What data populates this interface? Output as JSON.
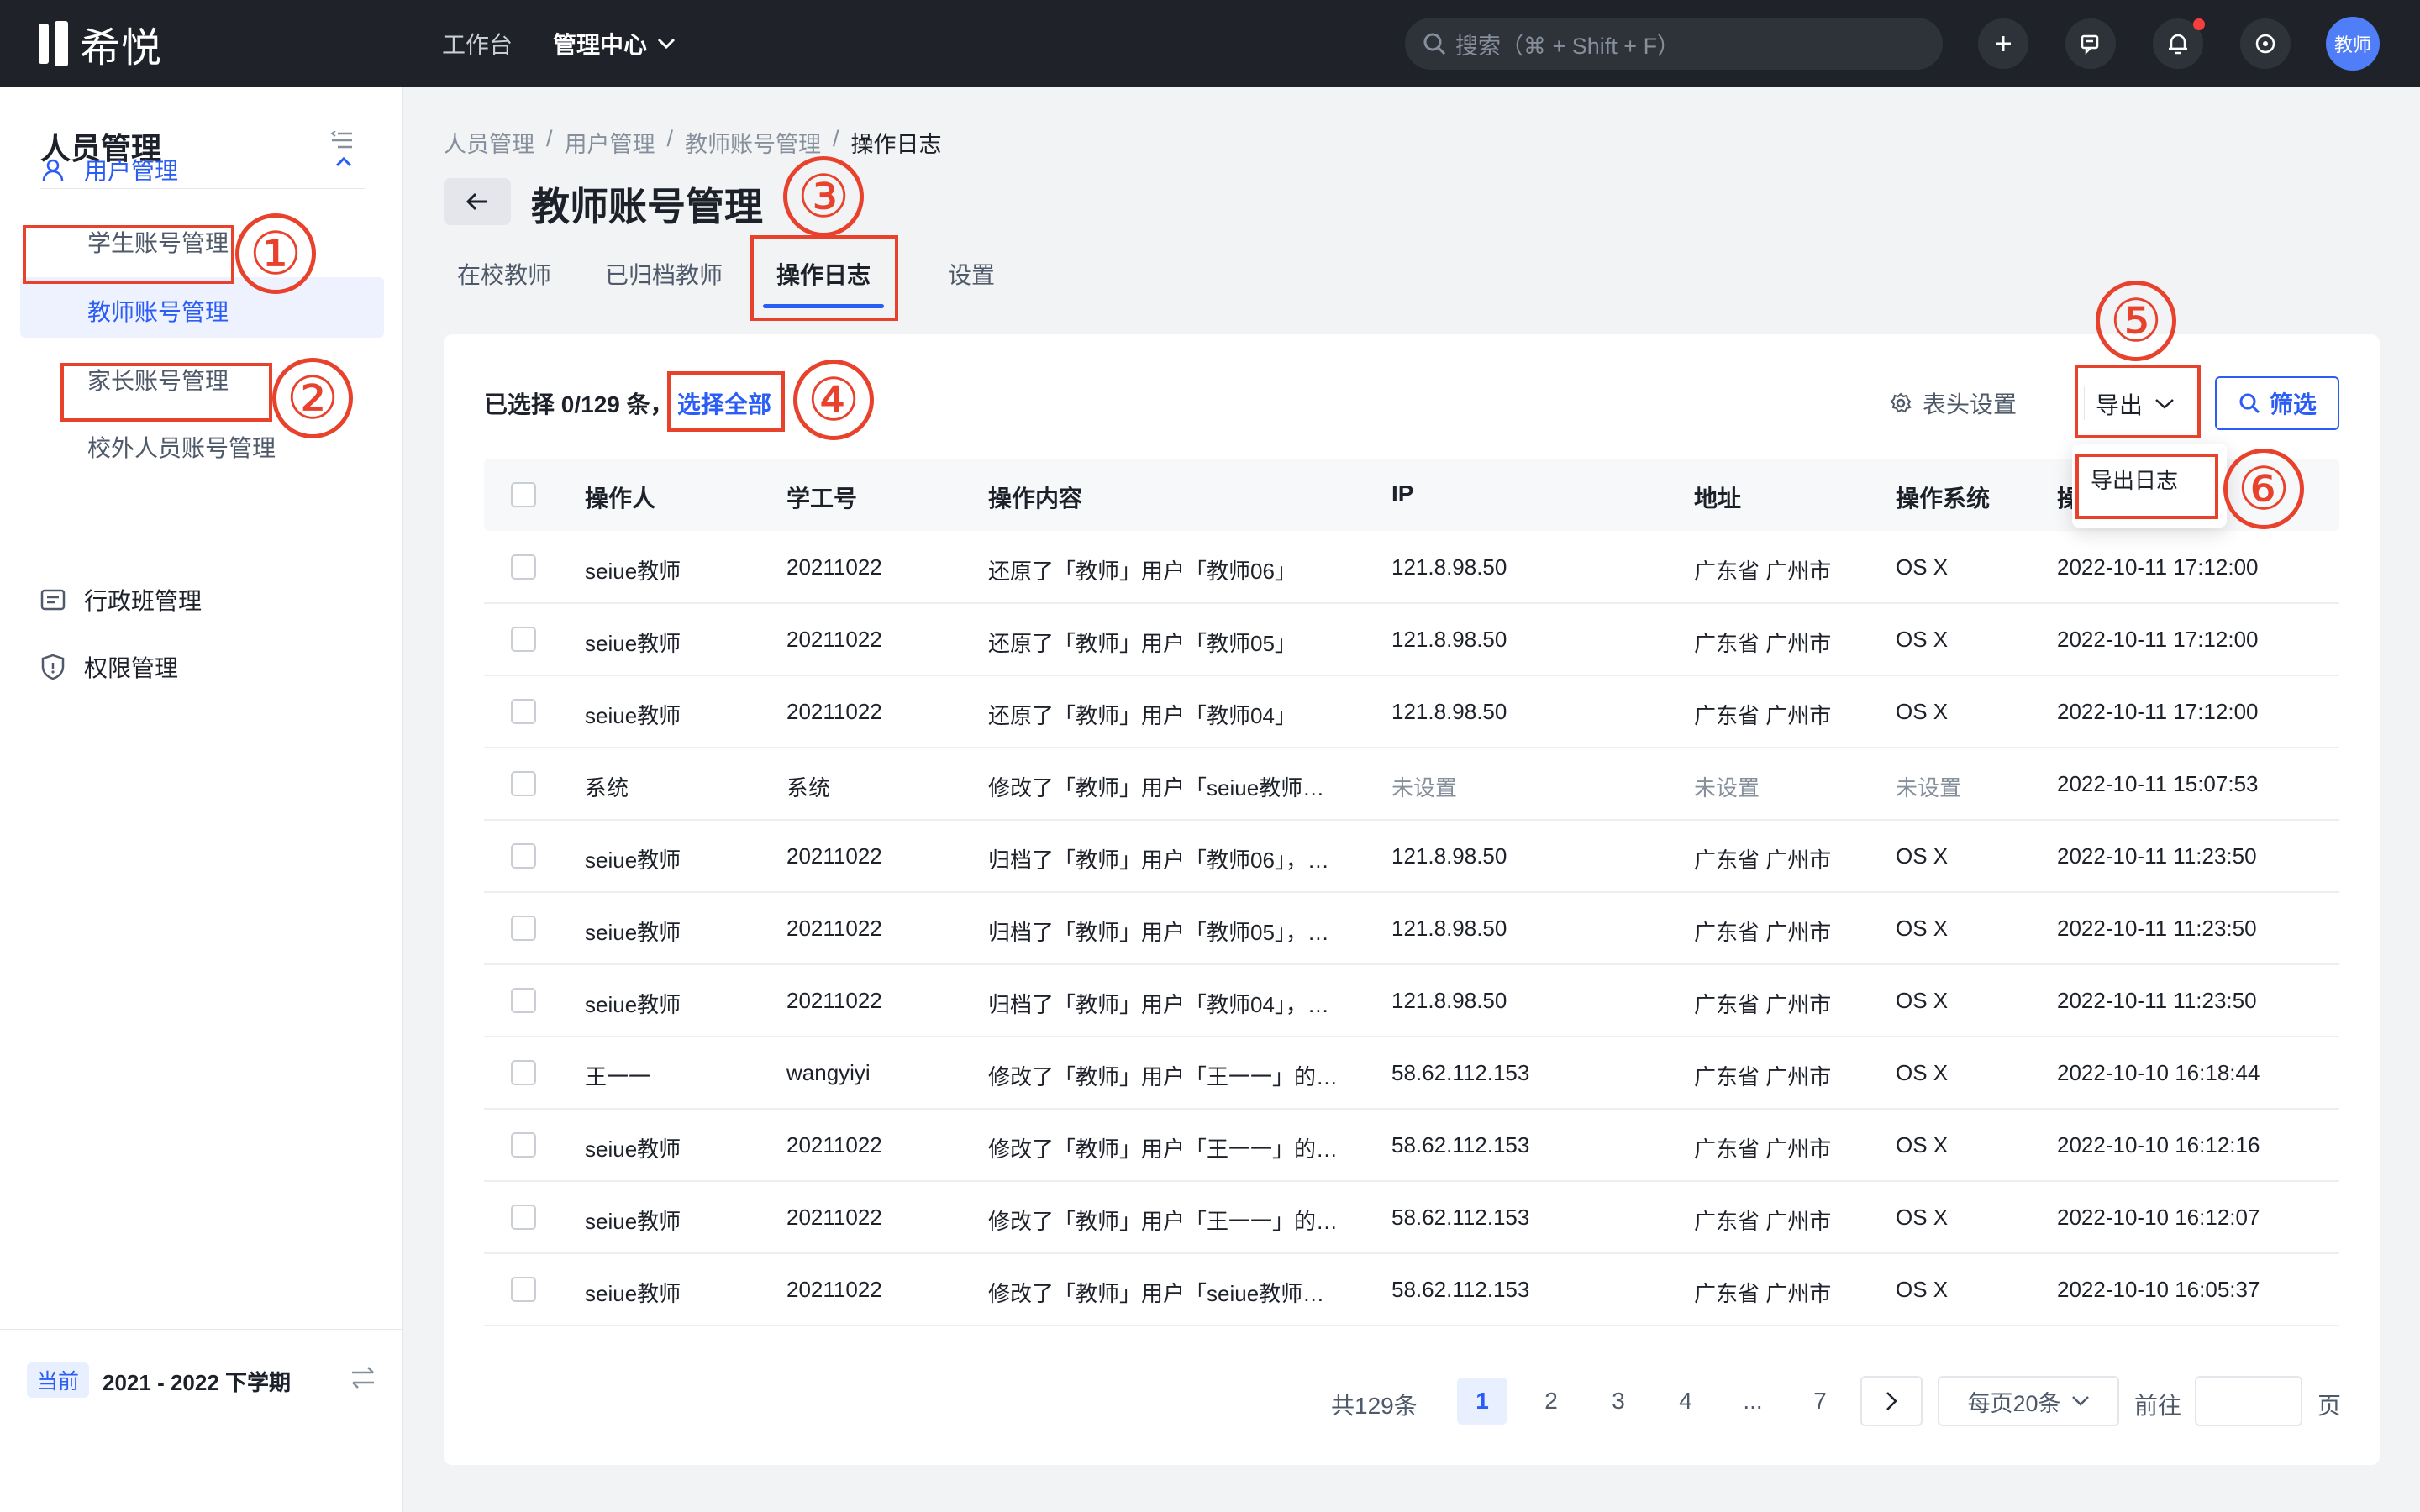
{
  "topbar": {
    "logo_text": "希悦",
    "nav_workbench": "工作台",
    "nav_admin": "管理中心",
    "search_placeholder": "搜索（⌘ + Shift + F）",
    "avatar_label": "教师"
  },
  "sidebar": {
    "title": "人员管理",
    "group_user": "用户管理",
    "sub_items": [
      "学生账号管理",
      "教师账号管理",
      "家长账号管理",
      "校外人员账号管理"
    ],
    "group_class": "行政班管理",
    "group_permission": "权限管理",
    "term_badge": "当前",
    "term_text": "2021 - 2022 下学期"
  },
  "breadcrumb": [
    "人员管理",
    "用户管理",
    "教师账号管理",
    "操作日志"
  ],
  "breadcrumb_sep": "/",
  "page_title": "教师账号管理",
  "tabs": [
    "在校教师",
    "已归档教师",
    "操作日志",
    "设置"
  ],
  "toolbar": {
    "selection_info": "已选择 0/129 条，",
    "select_all": "选择全部",
    "column_settings": "表头设置",
    "export": "导出",
    "filter": "筛选"
  },
  "export_menu": {
    "item": "导出日志"
  },
  "table": {
    "headers": [
      "操作人",
      "学工号",
      "操作内容",
      "IP",
      "地址",
      "操作系统",
      "操"
    ],
    "rows": [
      {
        "operator": "seiue教师",
        "id": "20211022",
        "content": "还原了「教师」用户「教师06」",
        "ip": "121.8.98.50",
        "address": "广东省 广州市",
        "os": "OS X",
        "time": "2022-10-11 17:12:00",
        "muted": false
      },
      {
        "operator": "seiue教师",
        "id": "20211022",
        "content": "还原了「教师」用户「教师05」",
        "ip": "121.8.98.50",
        "address": "广东省 广州市",
        "os": "OS X",
        "time": "2022-10-11 17:12:00",
        "muted": false
      },
      {
        "operator": "seiue教师",
        "id": "20211022",
        "content": "还原了「教师」用户「教师04」",
        "ip": "121.8.98.50",
        "address": "广东省 广州市",
        "os": "OS X",
        "time": "2022-10-11 17:12:00",
        "muted": false
      },
      {
        "operator": "系统",
        "id": "系统",
        "content": "修改了「教师」用户「seiue教师…",
        "ip": "未设置",
        "address": "未设置",
        "os": "未设置",
        "time": "2022-10-11 15:07:53",
        "muted": true
      },
      {
        "operator": "seiue教师",
        "id": "20211022",
        "content": "归档了「教师」用户「教师06」，…",
        "ip": "121.8.98.50",
        "address": "广东省 广州市",
        "os": "OS X",
        "time": "2022-10-11 11:23:50",
        "muted": false
      },
      {
        "operator": "seiue教师",
        "id": "20211022",
        "content": "归档了「教师」用户「教师05」，…",
        "ip": "121.8.98.50",
        "address": "广东省 广州市",
        "os": "OS X",
        "time": "2022-10-11 11:23:50",
        "muted": false
      },
      {
        "operator": "seiue教师",
        "id": "20211022",
        "content": "归档了「教师」用户「教师04」，…",
        "ip": "121.8.98.50",
        "address": "广东省 广州市",
        "os": "OS X",
        "time": "2022-10-11 11:23:50",
        "muted": false
      },
      {
        "operator": "王一一",
        "id": "wangyiyi",
        "content": "修改了「教师」用户「王一一」的…",
        "ip": "58.62.112.153",
        "address": "广东省 广州市",
        "os": "OS X",
        "time": "2022-10-10 16:18:44",
        "muted": false
      },
      {
        "operator": "seiue教师",
        "id": "20211022",
        "content": "修改了「教师」用户「王一一」的…",
        "ip": "58.62.112.153",
        "address": "广东省 广州市",
        "os": "OS X",
        "time": "2022-10-10 16:12:16",
        "muted": false
      },
      {
        "operator": "seiue教师",
        "id": "20211022",
        "content": "修改了「教师」用户「王一一」的…",
        "ip": "58.62.112.153",
        "address": "广东省 广州市",
        "os": "OS X",
        "time": "2022-10-10 16:12:07",
        "muted": false
      },
      {
        "operator": "seiue教师",
        "id": "20211022",
        "content": "修改了「教师」用户「seiue教师…",
        "ip": "58.62.112.153",
        "address": "广东省 广州市",
        "os": "OS X",
        "time": "2022-10-10 16:05:37",
        "muted": false
      }
    ]
  },
  "pagination": {
    "total": "共129条",
    "pages": [
      "1",
      "2",
      "3",
      "4",
      "...",
      "7"
    ],
    "current": "1",
    "page_size": "每页20条",
    "goto_label": "前往",
    "page_unit": "页"
  },
  "annotations": [
    "①",
    "②",
    "③",
    "④",
    "⑤",
    "⑥"
  ],
  "colors": {
    "accent": "#2a5cf6",
    "annotation": "#e8412c",
    "topbar": "#1f2329"
  }
}
